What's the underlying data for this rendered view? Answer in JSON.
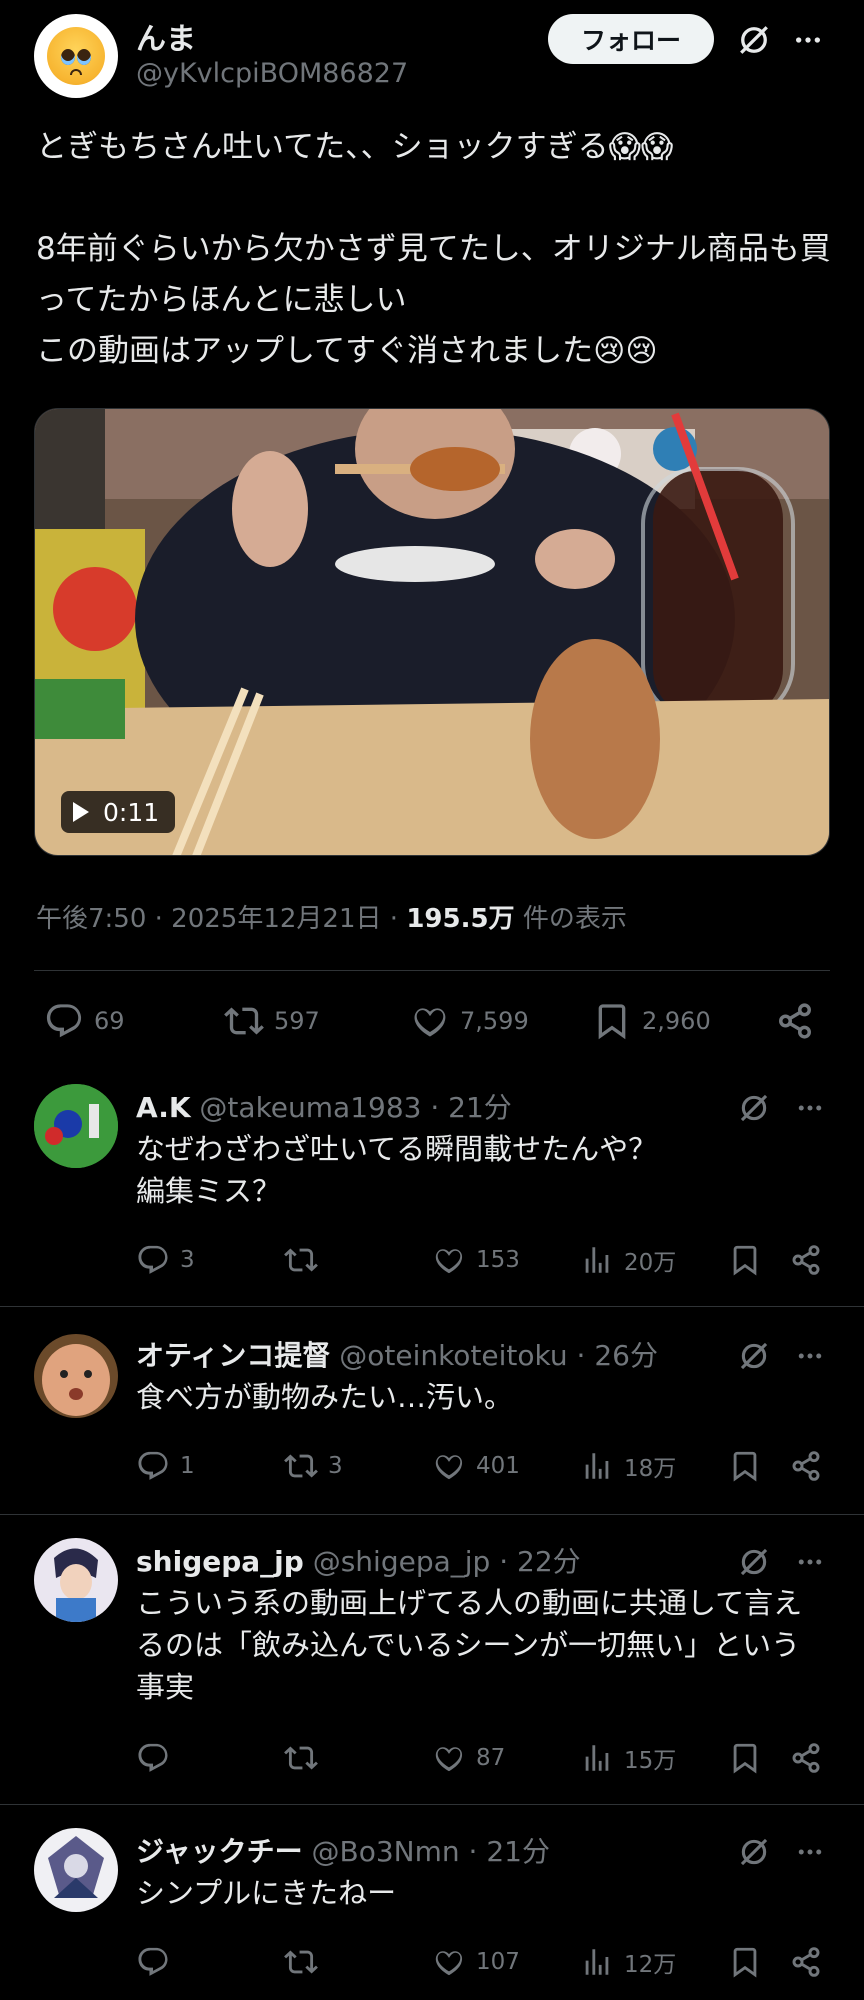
{
  "post": {
    "display_name": "んま",
    "handle": "@yKvlcpiBOM86827",
    "follow_label": "フォロー",
    "text": "とぎもちさん吐いてた、、ショックすぎる😱😱\n\n8年前ぐらいから欠かさず見てたし、オリジナル商品も買ってたからほんとに悲しい\nこの動画はアップしてすぐ消されました😢😢",
    "video_duration": "0:11",
    "time": "午後7:50 · 2025年12月21日 · ",
    "views_count": "195.5万",
    "views_label": " 件の表示",
    "replies": "69",
    "reposts": "597",
    "likes": "7,599",
    "bookmarks": "2,960"
  },
  "replies": [
    {
      "name": "A.K",
      "handle_time": " @takeuma1983 · 21分",
      "text": "なぜわざわざ吐いてる瞬間載せたんや？\n編集ミス？",
      "replies": "3",
      "reposts": "",
      "likes": "153",
      "views": "20万"
    },
    {
      "name": "オティンコ提督",
      "handle_time": " @oteinkoteitoku · 26分",
      "text": "食べ方が動物みたい…汚い。",
      "replies": "1",
      "reposts": "3",
      "likes": "401",
      "views": "18万"
    },
    {
      "name": "shigepa_jp",
      "handle_time": " @shigepa_jp · 22分",
      "text": "こういう系の動画上げてる人の動画に共通して言えるのは「飲み込んでいるシーンが一切無い」という事実",
      "replies": "",
      "reposts": "",
      "likes": "87",
      "views": "15万"
    },
    {
      "name": "ジャックチー",
      "handle_time": " @Bo3Nmn · 21分",
      "text": "シンプルにきたねー",
      "replies": "",
      "reposts": "",
      "likes": "107",
      "views": "12万"
    }
  ]
}
